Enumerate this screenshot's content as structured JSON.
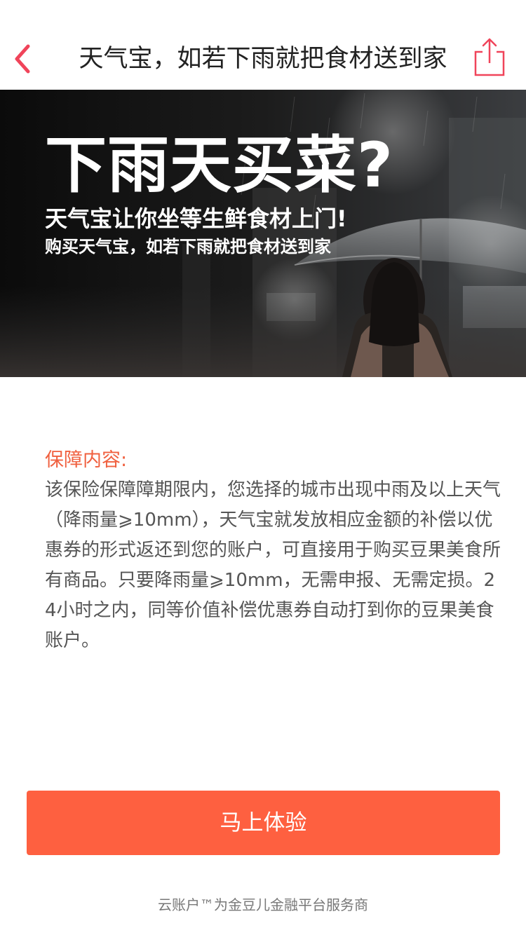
{
  "header": {
    "title": "天气宝，如若下雨就把食材送到家",
    "back_icon": "chevron-left-icon",
    "share_icon": "share-icon",
    "accent_color": "#f0445a"
  },
  "banner": {
    "headline": "下雨天买菜?",
    "subtitle": "天气宝让你坐等生鲜食材上门!",
    "tagline": "购买天气宝，如若下雨就把食材送到家"
  },
  "content": {
    "title": "保障内容:",
    "body": "该保险保障障期限内，您选择的城市出现中雨及以上天气（降雨量⩾10mm），天气宝就发放相应金额的补偿以优惠券的形式返还到您的账户，可直接用于购买豆果美食所有商品。只要降雨量⩾10mm，无需申报、无需定损。24小时之内，同等价值补偿优惠券自动打到你的豆果美食账户。",
    "title_color": "#f0603f"
  },
  "cta": {
    "label": "马上体验",
    "color": "#fe6040"
  },
  "footer": {
    "text": "云账户™为金豆儿金融平台服务商"
  }
}
